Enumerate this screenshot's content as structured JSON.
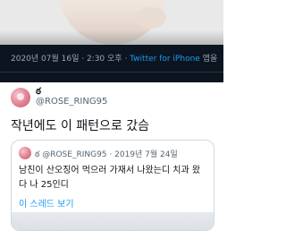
{
  "previous_tweet": {
    "timestamp": "2020년 07월 16일 · 2:30 오후 · ",
    "source_link": "Twitter for iPhone",
    "source_suffix": " 앱을"
  },
  "tweet": {
    "display_name": "ఠ",
    "handle": "@ROSE_RING95",
    "text": "작년에도 이 패턴으로 갔슴",
    "quoted": {
      "display_name": "ఠ",
      "handle": "@ROSE_RING95",
      "date": "· 2019년 7월 24일",
      "text": "남친이 산오징어 먹으러 가재서 나왔는디 치과 왔다 나 25인디",
      "thread_link": "이 스레드 보기"
    }
  },
  "colors": {
    "link": "#1d9bf0",
    "dark_band": "#0c1420",
    "border": "#cfd9de"
  }
}
